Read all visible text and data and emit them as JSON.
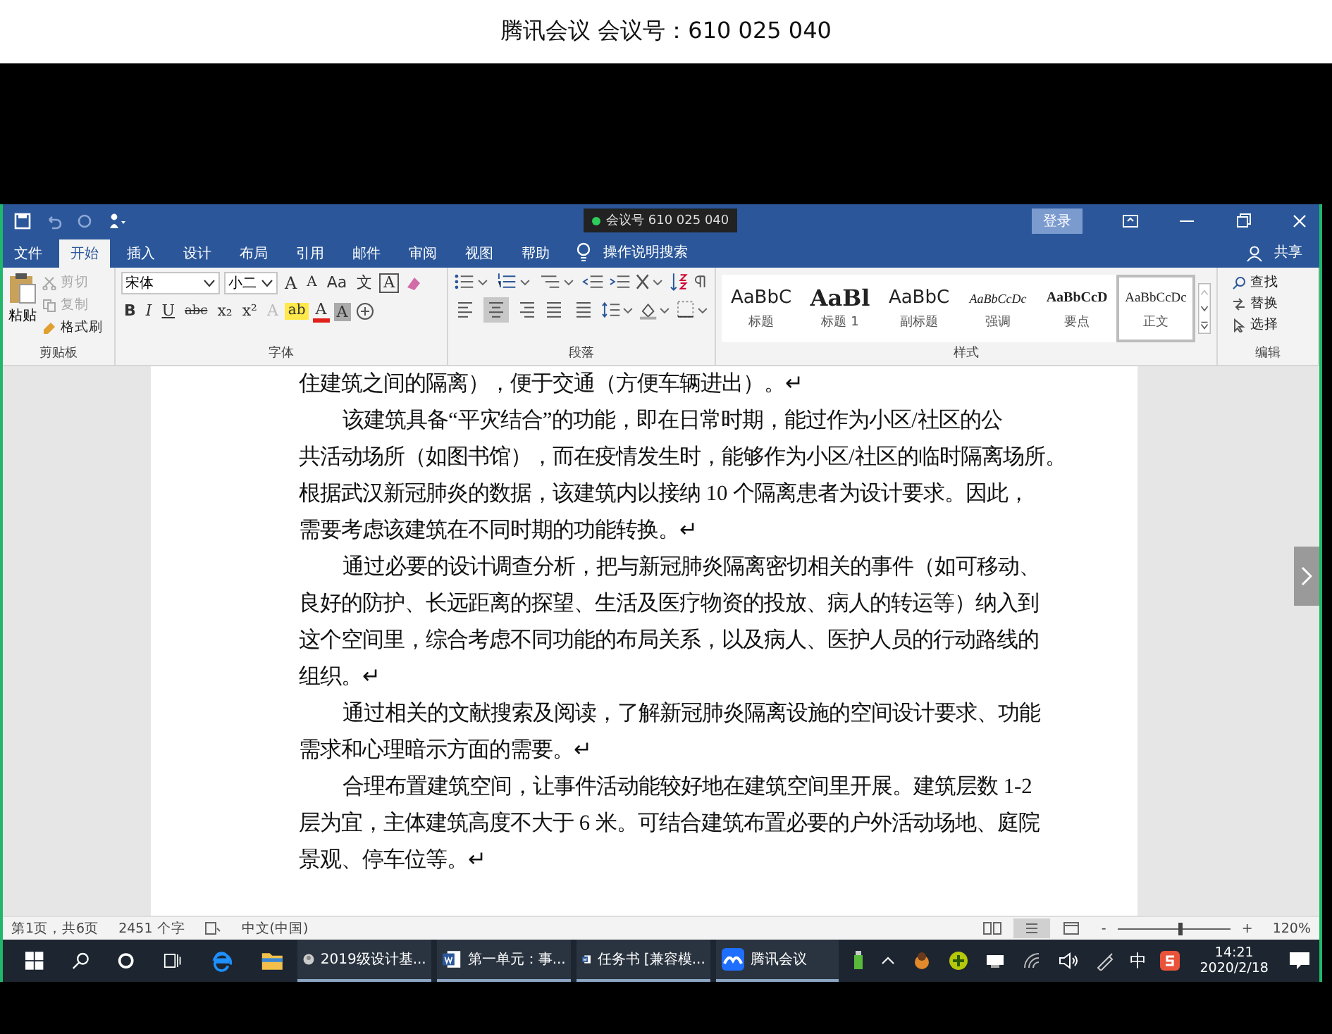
{
  "meeting_bar": {
    "title": "腾讯会议 会议号：610 025 040"
  },
  "word": {
    "title_bar": {
      "meeting_tag": "会议号 610 025 040",
      "login_button": "登录"
    },
    "tabs": [
      {
        "label": "文件",
        "selected": false
      },
      {
        "label": "开始",
        "selected": true
      },
      {
        "label": "插入",
        "selected": false
      },
      {
        "label": "设计",
        "selected": false
      },
      {
        "label": "布局",
        "selected": false
      },
      {
        "label": "引用",
        "selected": false
      },
      {
        "label": "邮件",
        "selected": false
      },
      {
        "label": "审阅",
        "selected": false
      },
      {
        "label": "视图",
        "selected": false
      },
      {
        "label": "帮助",
        "selected": false
      }
    ],
    "tell_me": "操作说明搜索",
    "share": "共享",
    "clipboard": {
      "paste": "粘贴",
      "cut": {
        "label": "剪切",
        "disabled": true
      },
      "copy": {
        "label": "复制",
        "disabled": true
      },
      "format_painter": {
        "label": "格式刷",
        "disabled": false
      },
      "label": "剪贴板"
    },
    "font": {
      "name": "宋体",
      "size": "小二",
      "label": "字体",
      "row1": [
        {
          "label": "A",
          "kind": "grow"
        },
        {
          "label": "A",
          "kind": "shrink"
        },
        {
          "label": "Aa",
          "kind": "case"
        },
        {
          "label": "文",
          "kind": "phonetic"
        },
        {
          "label": "A",
          "kind": "border"
        }
      ],
      "row2": [
        {
          "label": "B",
          "kind": "bold"
        },
        {
          "label": "I",
          "kind": "italic"
        },
        {
          "label": "U",
          "kind": "underline"
        },
        {
          "label": "abc",
          "kind": "strike"
        },
        {
          "label": "x₂",
          "kind": "sub"
        },
        {
          "label": "x²",
          "kind": "sup"
        },
        {
          "label": "A",
          "kind": "effects"
        },
        {
          "label": "ab",
          "kind": "highlight"
        },
        {
          "label": "A",
          "kind": "color"
        },
        {
          "label": "A",
          "kind": "shade"
        }
      ]
    },
    "paragraph": {
      "label": "段落",
      "align": [
        {
          "kind": "left",
          "selected": false
        },
        {
          "kind": "center",
          "selected": true
        },
        {
          "kind": "right",
          "selected": false
        },
        {
          "kind": "justify",
          "selected": false
        },
        {
          "kind": "distributed",
          "selected": false
        }
      ]
    },
    "styles": {
      "label": "样式",
      "items": [
        {
          "sample": "AaBbC",
          "name": "标题",
          "kind": "title",
          "selected": false
        },
        {
          "sample": "AaBl",
          "name": "标题 1",
          "kind": "heading",
          "selected": false
        },
        {
          "sample": "AaBbC",
          "name": "副标题",
          "kind": "subtitle",
          "selected": false
        },
        {
          "sample": "AaBbCcDc",
          "name": "强调",
          "kind": "emphasis",
          "selected": false
        },
        {
          "sample": "AaBbCcD",
          "name": "要点",
          "kind": "strong",
          "selected": false
        },
        {
          "sample": "AaBbCcDc",
          "name": "正文",
          "kind": "normal",
          "selected": true
        }
      ]
    },
    "editing": {
      "label": "编辑",
      "find": "查找",
      "replace": "替换",
      "select": "选择"
    },
    "document": {
      "paragraphs": [
        {
          "indented": false,
          "lines": [
            "住建筑之间的隔离），便于交通（方便车辆进出）。↵"
          ]
        },
        {
          "indented": true,
          "lines": [
            "该建筑具备“平灾结合”的功能，即在日常时期，能过作为小区/社区的公",
            "共活动场所（如图书馆），而在疫情发生时，能够作为小区/社区的临时隔离场所。",
            "根据武汉新冠肺炎的数据，该建筑内以接纳 10 个隔离患者为设计要求。因此，",
            "需要考虑该建筑在不同时期的功能转换。↵"
          ]
        },
        {
          "indented": true,
          "lines": [
            "通过必要的设计调查分析，把与新冠肺炎隔离密切相关的事件（如可移动、",
            "良好的防护、长远距离的探望、生活及医疗物资的投放、病人的转运等）纳入到",
            "这个空间里，综合考虑不同功能的布局关系，以及病人、医护人员的行动路线的",
            "组织。↵"
          ]
        },
        {
          "indented": true,
          "lines": [
            "通过相关的文献搜索及阅读，了解新冠肺炎隔离设施的空间设计要求、功能",
            "需求和心理暗示方面的需要。↵"
          ]
        },
        {
          "indented": true,
          "lines": [
            "合理布置建筑空间，让事件活动能较好地在建筑空间里开展。建筑层数 1-2",
            "层为宜，主体建筑高度不大于 6 米。可结合建筑布置必要的户外活动场地、庭院",
            "景观、停车位等。↵"
          ]
        }
      ]
    },
    "status_bar": {
      "page": "第1页，共6页",
      "words": "2451 个字",
      "language": "中文(中国)",
      "views": [
        {
          "kind": "read",
          "selected": false
        },
        {
          "kind": "print",
          "selected": true
        },
        {
          "kind": "web",
          "selected": false
        }
      ],
      "zoom_minus": "-",
      "zoom_plus": "+",
      "zoom": {
        "level": 0.55
      },
      "zoom_text": "120%"
    }
  },
  "taskbar": {
    "apps": [
      {
        "label": "2019级设计基...",
        "kind": "browser"
      },
      {
        "label": "第一单元：事...",
        "kind": "word"
      },
      {
        "label": "任务书 [兼容模...",
        "kind": "word"
      },
      {
        "label": "腾讯会议",
        "kind": "meeting"
      }
    ],
    "ime": "中",
    "time": "14:21",
    "date": "2020/2/18"
  }
}
